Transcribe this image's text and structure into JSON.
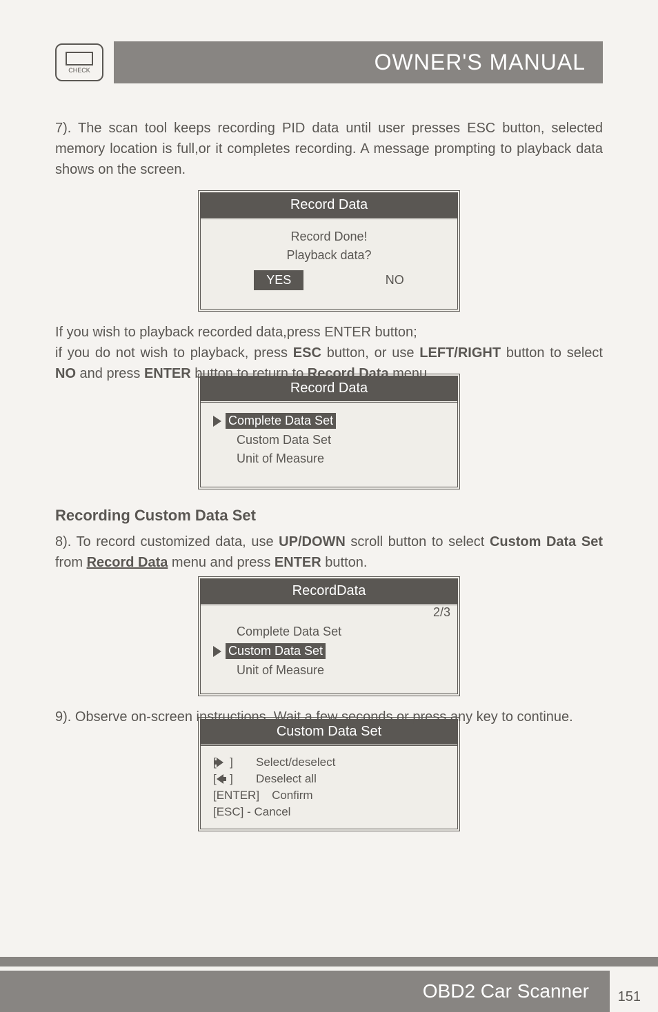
{
  "header": {
    "check_label": "CHECK",
    "title": "OWNER'S MANUAL"
  },
  "paragraphs": {
    "p7": "7). The scan tool keeps recording PID data until user presses ESC button, selected memory location is full,or it completes recording. A message prompting to playback data shows on the screen.",
    "p_playback1": "If you wish to playback recorded data,press ENTER button;",
    "p_playback2a": "if you do not wish to playback, press ",
    "p_playback2b": " button, or use ",
    "p_playback2c": " button to select ",
    "p_playback2d": " and press ",
    "p_playback2e": " button to return to ",
    "p_playback2f": " menu.",
    "heading": "Recording Custom Data Set",
    "p8a": "8). To record customized data, use ",
    "p8b": " scroll button to select ",
    "p8c": " from ",
    "p8d": " menu and press ",
    "p8e": " button.",
    "p9": "9). Observe on-screen instructions. Wait a few seconds or press any key to continue."
  },
  "bold_terms": {
    "esc": "ESC",
    "leftright": "LEFT/RIGHT",
    "no": "NO",
    "enter": "ENTER",
    "record_data": "Record Data",
    "updown": "UP/DOWN",
    "custom_data_set": "Custom Data Set"
  },
  "screens": {
    "s1": {
      "title": "Record Data",
      "line1": "Record Done!",
      "line2": "Playback data?",
      "yes": "YES",
      "no": "NO"
    },
    "s2": {
      "title": "Record Data",
      "item1": "Complete Data Set",
      "item2": "Custom Data Set",
      "item3": "Unit of Measure"
    },
    "s3": {
      "title": "RecordData",
      "indicator": "2/3",
      "item1": "Complete Data Set",
      "item2": "Custom Data Set",
      "item3": "Unit of Measure"
    },
    "s4": {
      "title": "Custom Data Set",
      "inst1": "Select/deselect",
      "inst2": "Deselect all",
      "inst3_key": "[ENTER]",
      "inst3_label": "Confirm",
      "inst4": "[ESC] - Cancel"
    }
  },
  "footer": {
    "product": "OBD2 Car Scanner",
    "page": "151"
  }
}
